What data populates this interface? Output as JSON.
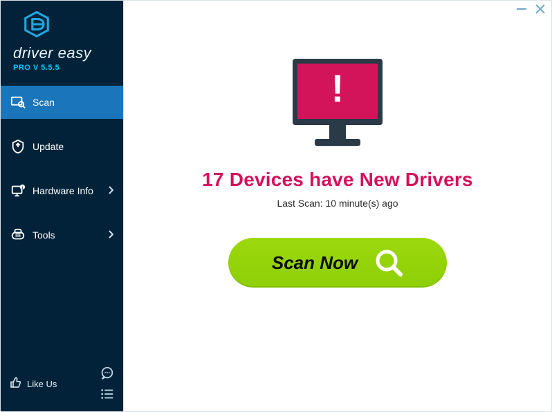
{
  "brand": {
    "name": "driver easy",
    "version": "PRO V 5.5.5"
  },
  "nav": {
    "scan": "Scan",
    "update": "Update",
    "hardware": "Hardware Info",
    "tools": "Tools"
  },
  "footer": {
    "like": "Like Us"
  },
  "main": {
    "headline": "17 Devices have New Drivers",
    "lastScan": "Last Scan: 10 minute(s) ago",
    "scanButton": "Scan Now"
  }
}
